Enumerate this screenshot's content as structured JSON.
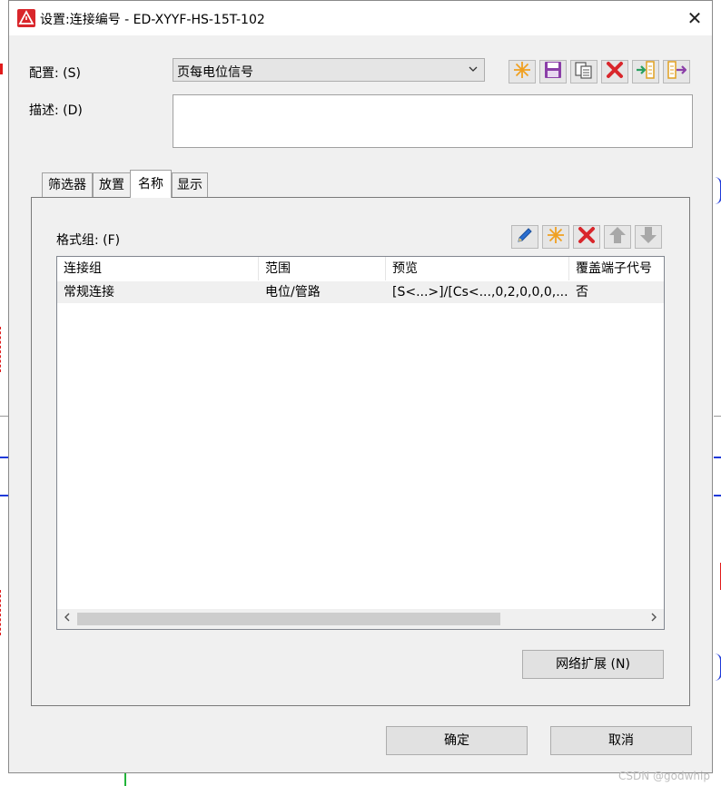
{
  "window": {
    "title": "设置:连接编号 - ED-XYYF-HS-15T-102",
    "close": "✕"
  },
  "config": {
    "label": "配置: (S)",
    "selected": "页每电位信号"
  },
  "description": {
    "label": "描述: (D)",
    "value": ""
  },
  "toolbar_top": {
    "icons": [
      "new-icon",
      "save-icon",
      "copy-icon",
      "delete-icon",
      "import-icon",
      "export-icon"
    ]
  },
  "tabs": [
    {
      "label": "筛选器"
    },
    {
      "label": "放置"
    },
    {
      "label": "名称"
    },
    {
      "label": "显示"
    }
  ],
  "format_group": {
    "label": "格式组: (F)",
    "icons": [
      "edit-icon",
      "new-icon",
      "delete-icon",
      "move-up-icon",
      "move-down-icon"
    ]
  },
  "table": {
    "columns": [
      "连接组",
      "范围",
      "预览",
      "覆盖端子代号"
    ],
    "rows": [
      [
        "常规连接",
        "电位/管路",
        "[S<...>]/[Cs<...,0,2,0,0,0,...",
        "否"
      ]
    ]
  },
  "buttons": {
    "network_expand": "网络扩展 (N)",
    "ok": "确定",
    "cancel": "取消"
  },
  "watermark": "CSDN @godwhip",
  "colors": {
    "accent_red": "#d9262b",
    "cad_red": "#e11b1b",
    "cad_blue": "#1f3ad9",
    "cad_green": "#22b43a"
  }
}
